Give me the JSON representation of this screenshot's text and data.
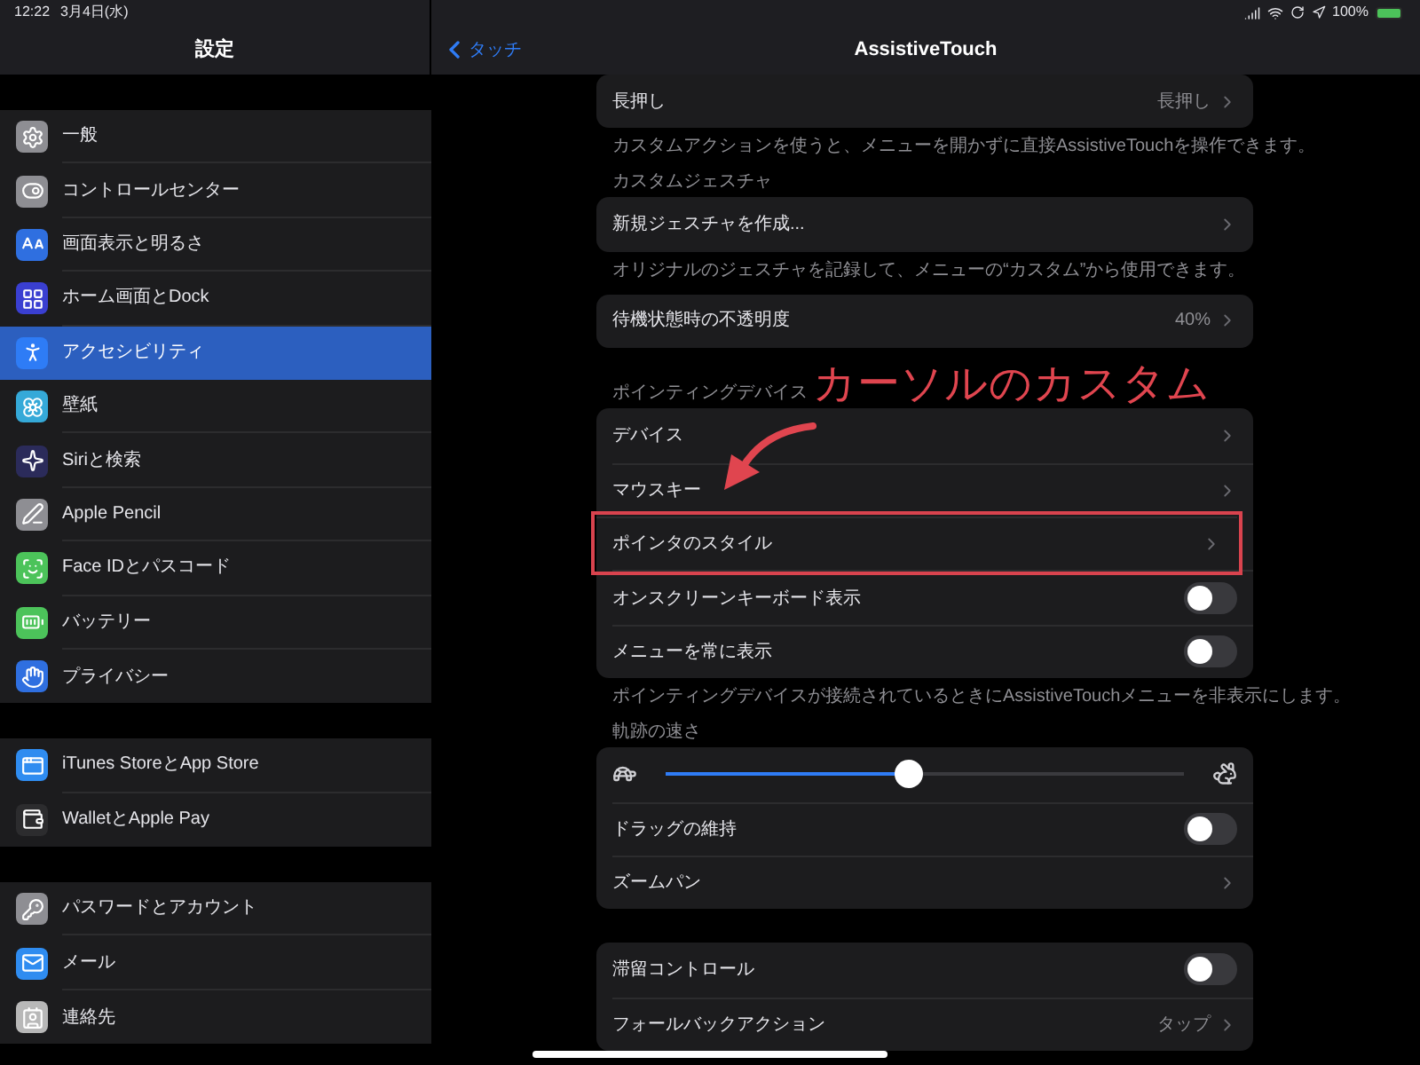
{
  "status_bar": {
    "time": "12:22",
    "date": "3月4日(水)",
    "battery": "100%"
  },
  "sidebar": {
    "title": "設定",
    "groups": [
      {
        "items": [
          {
            "label": "一般",
            "color": "#8e8e93",
            "selected": false
          },
          {
            "label": "コントロールセンター",
            "color": "#8e8e93",
            "selected": false
          },
          {
            "label": "画面表示と明るさ",
            "color": "#2f6fe0",
            "selected": false
          },
          {
            "label": "ホーム画面とDock",
            "color": "#3a3fd1",
            "selected": false
          },
          {
            "label": "アクセシビリティ",
            "color": "#2e7cf6",
            "selected": true
          },
          {
            "label": "壁紙",
            "color": "#35a9d8",
            "selected": false
          },
          {
            "label": "Siriと検索",
            "color": "#2b2b5a",
            "selected": false
          },
          {
            "label": "Apple Pencil",
            "color": "#8e8e93",
            "selected": false
          },
          {
            "label": "Face IDとパスコード",
            "color": "#4cc35a",
            "selected": false
          },
          {
            "label": "バッテリー",
            "color": "#4cc35a",
            "selected": false
          },
          {
            "label": "プライバシー",
            "color": "#2f6fe0",
            "selected": false
          }
        ]
      },
      {
        "items": [
          {
            "label": "iTunes StoreとApp Store",
            "color": "#2f8cf0",
            "selected": false
          },
          {
            "label": "WalletとApple Pay",
            "color": "#2c2c2e",
            "selected": false
          }
        ]
      },
      {
        "items": [
          {
            "label": "パスワードとアカウント",
            "color": "#8e8e93",
            "selected": false
          },
          {
            "label": "メール",
            "color": "#2f8cf0",
            "selected": false
          },
          {
            "label": "連絡先",
            "color": "#b8b8b8",
            "selected": false
          }
        ]
      }
    ]
  },
  "nav": {
    "back": "タッチ",
    "title": "AssistiveTouch"
  },
  "sections": [
    {
      "rows": [
        {
          "kind": "link",
          "label": "長押し",
          "value": "長押し",
          "highlighted": false
        }
      ],
      "footer": "カスタムアクションを使うと、メニューを開かずに直接AssistiveTouchを操作できます。"
    },
    {
      "header": "カスタムジェスチャ",
      "rows": [
        {
          "kind": "link",
          "label": "新規ジェスチャを作成...",
          "highlighted": false
        }
      ],
      "footer": "オリジナルのジェスチャを記録して、メニューの“カスタム”から使用できます。"
    },
    {
      "rows": [
        {
          "kind": "link",
          "label": "待機状態時の不透明度",
          "value": "40%",
          "highlighted": false
        }
      ]
    },
    {
      "header": "ポインティングデバイス",
      "rows": [
        {
          "kind": "link",
          "label": "デバイス",
          "highlighted": false
        },
        {
          "kind": "link",
          "label": "マウスキー",
          "highlighted": false
        },
        {
          "kind": "link",
          "label": "ポインタのスタイル",
          "highlighted": true
        },
        {
          "kind": "toggle",
          "label": "オンスクリーンキーボード表示",
          "on": false
        },
        {
          "kind": "toggle",
          "label": "メニューを常に表示",
          "on": false
        }
      ],
      "footer": "ポインティングデバイスが接続されているときにAssistiveTouchメニューを非表示にします。"
    },
    {
      "header": "軌跡の速さ",
      "rows": [
        {
          "kind": "slider",
          "level": 0.47
        },
        {
          "kind": "toggle",
          "label": "ドラッグの維持",
          "on": false
        },
        {
          "kind": "link",
          "label": "ズームパン",
          "highlighted": false
        }
      ]
    },
    {
      "rows": [
        {
          "kind": "toggle",
          "label": "滞留コントロール",
          "on": false
        },
        {
          "kind": "link",
          "label": "フォールバックアクション",
          "value": "タップ",
          "highlighted": false
        }
      ]
    }
  ],
  "annotation": {
    "label": "カーソルのカスタム"
  }
}
